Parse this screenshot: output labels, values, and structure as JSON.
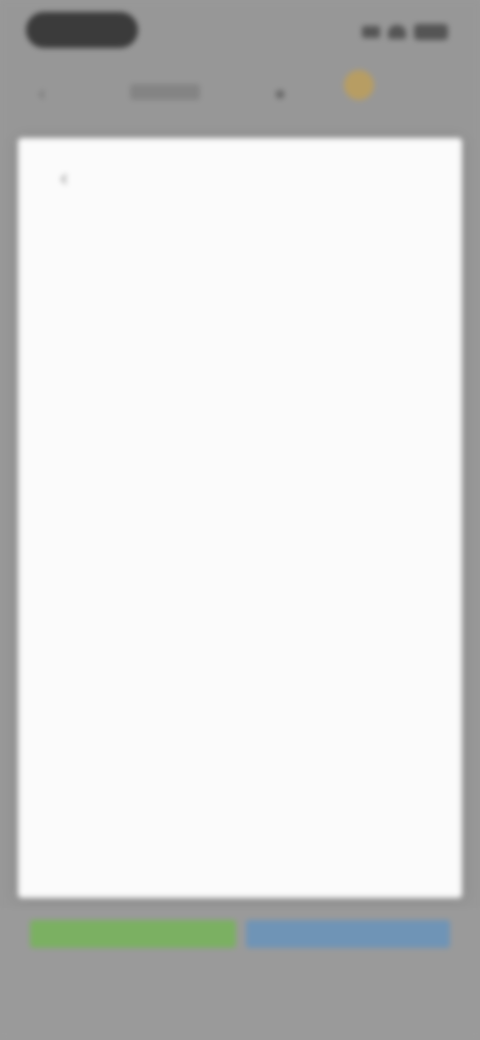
{
  "colors": {
    "overlay": "#979797",
    "dialog_bg": "#fbfbfb",
    "accept_button": "#7bb062",
    "secondary_button": "#6f94b6",
    "coin_icon": "#b79d63"
  },
  "toolbar": {
    "back_icon": "back-icon",
    "user_icon": "user-icon",
    "coin_icon": "coin-icon"
  },
  "dialog": {
    "title": "",
    "title_suffix": "",
    "close_icon": "close-icon",
    "sections": [
      {
        "heading": "",
        "paragraphs": [
          "",
          ""
        ]
      },
      {
        "heading": "",
        "paragraphs": [
          "",
          "",
          ""
        ]
      }
    ],
    "bold_paragraph": "",
    "final_paragraph": ""
  },
  "actions": {
    "left_label": "",
    "right_label": ""
  }
}
